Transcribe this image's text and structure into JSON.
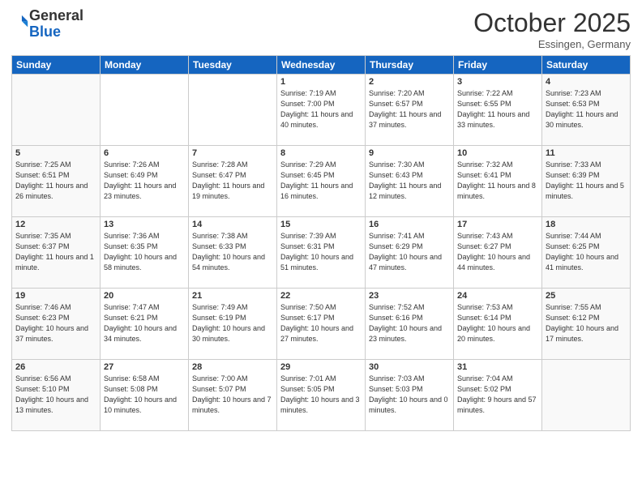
{
  "header": {
    "logo_line1": "General",
    "logo_line2": "Blue",
    "month": "October 2025",
    "location": "Essingen, Germany"
  },
  "days_of_week": [
    "Sunday",
    "Monday",
    "Tuesday",
    "Wednesday",
    "Thursday",
    "Friday",
    "Saturday"
  ],
  "weeks": [
    [
      {
        "day": "",
        "info": ""
      },
      {
        "day": "",
        "info": ""
      },
      {
        "day": "",
        "info": ""
      },
      {
        "day": "1",
        "info": "Sunrise: 7:19 AM\nSunset: 7:00 PM\nDaylight: 11 hours and 40 minutes."
      },
      {
        "day": "2",
        "info": "Sunrise: 7:20 AM\nSunset: 6:57 PM\nDaylight: 11 hours and 37 minutes."
      },
      {
        "day": "3",
        "info": "Sunrise: 7:22 AM\nSunset: 6:55 PM\nDaylight: 11 hours and 33 minutes."
      },
      {
        "day": "4",
        "info": "Sunrise: 7:23 AM\nSunset: 6:53 PM\nDaylight: 11 hours and 30 minutes."
      }
    ],
    [
      {
        "day": "5",
        "info": "Sunrise: 7:25 AM\nSunset: 6:51 PM\nDaylight: 11 hours and 26 minutes."
      },
      {
        "day": "6",
        "info": "Sunrise: 7:26 AM\nSunset: 6:49 PM\nDaylight: 11 hours and 23 minutes."
      },
      {
        "day": "7",
        "info": "Sunrise: 7:28 AM\nSunset: 6:47 PM\nDaylight: 11 hours and 19 minutes."
      },
      {
        "day": "8",
        "info": "Sunrise: 7:29 AM\nSunset: 6:45 PM\nDaylight: 11 hours and 16 minutes."
      },
      {
        "day": "9",
        "info": "Sunrise: 7:30 AM\nSunset: 6:43 PM\nDaylight: 11 hours and 12 minutes."
      },
      {
        "day": "10",
        "info": "Sunrise: 7:32 AM\nSunset: 6:41 PM\nDaylight: 11 hours and 8 minutes."
      },
      {
        "day": "11",
        "info": "Sunrise: 7:33 AM\nSunset: 6:39 PM\nDaylight: 11 hours and 5 minutes."
      }
    ],
    [
      {
        "day": "12",
        "info": "Sunrise: 7:35 AM\nSunset: 6:37 PM\nDaylight: 11 hours and 1 minute."
      },
      {
        "day": "13",
        "info": "Sunrise: 7:36 AM\nSunset: 6:35 PM\nDaylight: 10 hours and 58 minutes."
      },
      {
        "day": "14",
        "info": "Sunrise: 7:38 AM\nSunset: 6:33 PM\nDaylight: 10 hours and 54 minutes."
      },
      {
        "day": "15",
        "info": "Sunrise: 7:39 AM\nSunset: 6:31 PM\nDaylight: 10 hours and 51 minutes."
      },
      {
        "day": "16",
        "info": "Sunrise: 7:41 AM\nSunset: 6:29 PM\nDaylight: 10 hours and 47 minutes."
      },
      {
        "day": "17",
        "info": "Sunrise: 7:43 AM\nSunset: 6:27 PM\nDaylight: 10 hours and 44 minutes."
      },
      {
        "day": "18",
        "info": "Sunrise: 7:44 AM\nSunset: 6:25 PM\nDaylight: 10 hours and 41 minutes."
      }
    ],
    [
      {
        "day": "19",
        "info": "Sunrise: 7:46 AM\nSunset: 6:23 PM\nDaylight: 10 hours and 37 minutes."
      },
      {
        "day": "20",
        "info": "Sunrise: 7:47 AM\nSunset: 6:21 PM\nDaylight: 10 hours and 34 minutes."
      },
      {
        "day": "21",
        "info": "Sunrise: 7:49 AM\nSunset: 6:19 PM\nDaylight: 10 hours and 30 minutes."
      },
      {
        "day": "22",
        "info": "Sunrise: 7:50 AM\nSunset: 6:17 PM\nDaylight: 10 hours and 27 minutes."
      },
      {
        "day": "23",
        "info": "Sunrise: 7:52 AM\nSunset: 6:16 PM\nDaylight: 10 hours and 23 minutes."
      },
      {
        "day": "24",
        "info": "Sunrise: 7:53 AM\nSunset: 6:14 PM\nDaylight: 10 hours and 20 minutes."
      },
      {
        "day": "25",
        "info": "Sunrise: 7:55 AM\nSunset: 6:12 PM\nDaylight: 10 hours and 17 minutes."
      }
    ],
    [
      {
        "day": "26",
        "info": "Sunrise: 6:56 AM\nSunset: 5:10 PM\nDaylight: 10 hours and 13 minutes."
      },
      {
        "day": "27",
        "info": "Sunrise: 6:58 AM\nSunset: 5:08 PM\nDaylight: 10 hours and 10 minutes."
      },
      {
        "day": "28",
        "info": "Sunrise: 7:00 AM\nSunset: 5:07 PM\nDaylight: 10 hours and 7 minutes."
      },
      {
        "day": "29",
        "info": "Sunrise: 7:01 AM\nSunset: 5:05 PM\nDaylight: 10 hours and 3 minutes."
      },
      {
        "day": "30",
        "info": "Sunrise: 7:03 AM\nSunset: 5:03 PM\nDaylight: 10 hours and 0 minutes."
      },
      {
        "day": "31",
        "info": "Sunrise: 7:04 AM\nSunset: 5:02 PM\nDaylight: 9 hours and 57 minutes."
      },
      {
        "day": "",
        "info": ""
      }
    ]
  ]
}
